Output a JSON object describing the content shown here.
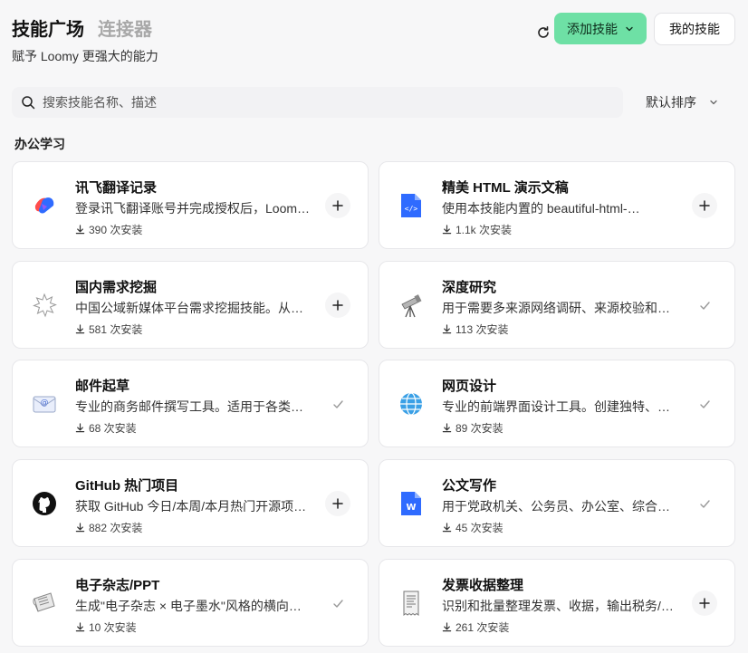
{
  "header": {
    "tab_active": "技能广场",
    "tab_inactive": "连接器",
    "subtitle": "赋予 Loomy 更强大的能力",
    "add_skill_label": "添加技能",
    "my_skills_label": "我的技能"
  },
  "search": {
    "placeholder": "搜索技能名称、描述"
  },
  "sort": {
    "label": "默认排序"
  },
  "section": {
    "title": "办公学习"
  },
  "colors": {
    "accent": "#6ee0a5"
  },
  "skills": [
    {
      "name": "讯飞翻译记录",
      "desc": "登录讯飞翻译账号并完成授权后，Loomy…",
      "installs": "390 次安装",
      "icon": "xunfei-icon",
      "action": "add"
    },
    {
      "name": "精美 HTML 演示文稿",
      "desc": "使用本技能内置的 beautiful-html-…",
      "installs": "1.1k 次安装",
      "icon": "html-doc-icon",
      "action": "add"
    },
    {
      "name": "国内需求挖掘",
      "desc": "中国公域新媒体平台需求挖掘技能。从…",
      "installs": "581 次安装",
      "icon": "burst-icon",
      "action": "add"
    },
    {
      "name": "深度研究",
      "desc": "用于需要多来源网络调研、来源校验和…",
      "installs": "113 次安装",
      "icon": "telescope-icon",
      "action": "installed"
    },
    {
      "name": "邮件起草",
      "desc": "专业的商务邮件撰写工具。适用于各类…",
      "installs": "68 次安装",
      "icon": "email-icon",
      "action": "installed"
    },
    {
      "name": "网页设计",
      "desc": "专业的前端界面设计工具。创建独特、…",
      "installs": "89 次安装",
      "icon": "globe-icon",
      "action": "installed"
    },
    {
      "name": "GitHub 热门项目",
      "desc": "获取 GitHub 今日/本周/本月热门开源项…",
      "installs": "882 次安装",
      "icon": "github-icon",
      "action": "add"
    },
    {
      "name": "公文写作",
      "desc": "用于党政机关、公务员、办公室、综合…",
      "installs": "45 次安装",
      "icon": "word-doc-icon",
      "action": "installed"
    },
    {
      "name": "电子杂志/PPT",
      "desc": "生成\"电子杂志 × 电子墨水\"风格的横向…",
      "installs": "10 次安装",
      "icon": "newspaper-icon",
      "action": "installed"
    },
    {
      "name": "发票收据整理",
      "desc": "识别和批量整理发票、收据，输出税务/…",
      "installs": "261 次安装",
      "icon": "receipt-icon",
      "action": "add"
    }
  ]
}
